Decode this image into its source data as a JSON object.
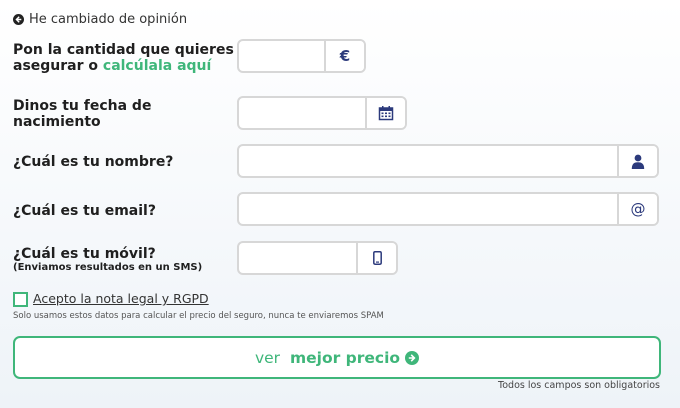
{
  "back_link": {
    "text": "He cambiado de opinión",
    "icon": "arrow-left-circle-icon"
  },
  "fields": {
    "amount": {
      "label_line1": "Pon la cantidad que quieres",
      "label_line2_prefix": "asegurar o ",
      "label_link": "calcúlala aquí",
      "value": "",
      "addon_text": "€"
    },
    "birthdate": {
      "label_line1": "Dinos tu fecha de",
      "label_line2": "nacimiento",
      "value": "",
      "addon_icon": "calendar-icon"
    },
    "name": {
      "label": "¿Cuál es tu nombre?",
      "value": "",
      "addon_icon": "user-icon"
    },
    "email": {
      "label": "¿Cuál es tu email?",
      "value": "",
      "addon_text": "@"
    },
    "mobile": {
      "label": "¿Cuál es tu móvil?",
      "sublabel": "(Enviamos resultados en un SMS)",
      "value": "",
      "addon_icon": "mobile-phone-icon"
    }
  },
  "legal": {
    "checkbox_label": "Acepto la nota legal y RGPD",
    "checked": false,
    "note": "Solo usamos estos datos para calcular el precio del seguro, nunca te enviaremos SPAM"
  },
  "cta": {
    "prefix": "ver ",
    "emphasis": "mejor precio",
    "icon": "arrow-right-circle-icon"
  },
  "required_note": "Todos los campos son obligatorios",
  "colors": {
    "accent": "#3fb67a",
    "icon": "#2c3a7c",
    "border": "#d7d7d7"
  }
}
